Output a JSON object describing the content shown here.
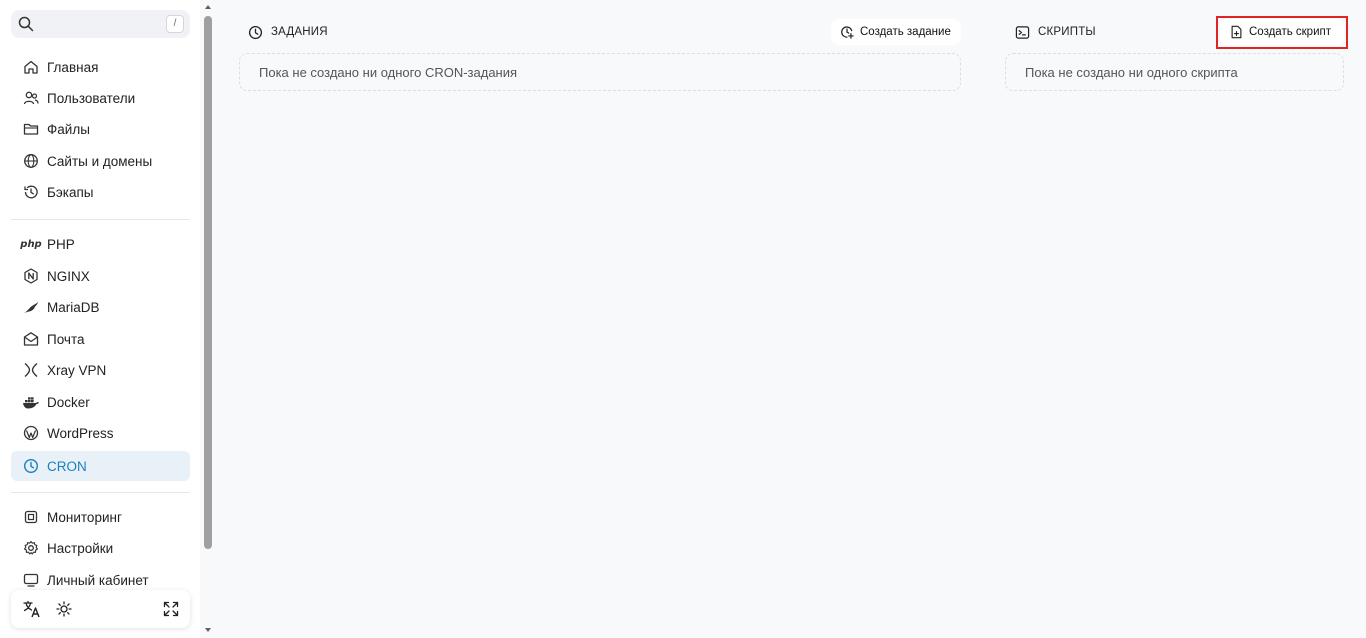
{
  "search": {
    "shortcut": "/"
  },
  "nav": {
    "group1": [
      {
        "label": "Главная",
        "icon": "home-icon"
      },
      {
        "label": "Пользователи",
        "icon": "users-icon"
      },
      {
        "label": "Файлы",
        "icon": "folder-icon"
      },
      {
        "label": "Сайты и домены",
        "icon": "globe-icon"
      },
      {
        "label": "Бэкапы",
        "icon": "history-icon"
      }
    ],
    "group2": [
      {
        "label": "PHP",
        "icon": "php-icon",
        "icon_text": "php"
      },
      {
        "label": "NGINX",
        "icon": "nginx-icon"
      },
      {
        "label": "MariaDB",
        "icon": "mariadb-icon"
      },
      {
        "label": "Почта",
        "icon": "mail-icon"
      },
      {
        "label": "Xray VPN",
        "icon": "xray-icon"
      },
      {
        "label": "Docker",
        "icon": "docker-icon"
      },
      {
        "label": "WordPress",
        "icon": "wordpress-icon"
      },
      {
        "label": "CRON",
        "icon": "clock-icon",
        "active": true
      }
    ],
    "group3": [
      {
        "label": "Мониторинг",
        "icon": "cpu-icon"
      },
      {
        "label": "Настройки",
        "icon": "gear-icon"
      },
      {
        "label": "Личный кабинет",
        "icon": "monitor-icon"
      }
    ]
  },
  "tasks": {
    "title": "ЗАДАНИЯ",
    "create_label": "Создать задание",
    "empty_text": "Пока не создано ни одного CRON-задания"
  },
  "scripts": {
    "title": "СКРИПТЫ",
    "create_label": "Создать скрипт",
    "empty_text": "Пока не создано ни одного скрипта"
  },
  "colors": {
    "accent": "#1a7fc1",
    "active_bg": "#e8f1f8",
    "highlight": "#e02424"
  }
}
